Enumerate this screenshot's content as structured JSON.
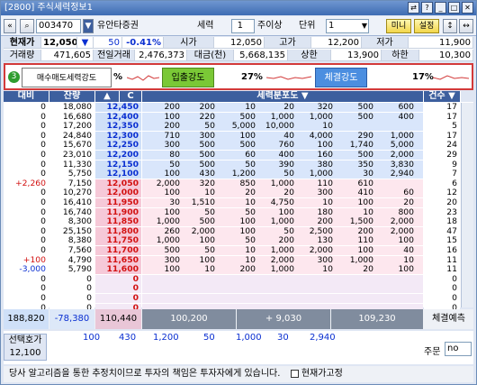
{
  "window": {
    "title": "[2800] 주식세력정보1"
  },
  "toolbar": {
    "code": "003470",
    "name": "유안타증권",
    "sel_label": "세력",
    "sel_value": "1",
    "period": "주이상",
    "unit_label": "단위",
    "unit_value": "1",
    "mini": "미니",
    "settings": "설정"
  },
  "quote": {
    "r1": [
      "현재가",
      "12,050",
      "▼",
      "50",
      "-0.41%",
      "시가",
      "12,050",
      "고가",
      "12,200",
      "저가",
      "11,900"
    ],
    "r2": [
      "거래량",
      "471,605",
      "전일거래",
      "2,476,373",
      "대금(천)",
      "5,668,135",
      "상한",
      "13,900",
      "하한",
      "10,300"
    ]
  },
  "gauge": {
    "step": "3",
    "tooltip": "매수매도세력강도",
    "pct1": "%",
    "label2": "입출강도",
    "pct2": "27%",
    "label3": "체결강도",
    "pct3": "17%"
  },
  "headers": {
    "diff": "대비",
    "remain": "잔량",
    "price_a": "▲",
    "price_c": "C",
    "dist": "세력분포도 ▼",
    "count": "건수 ▼"
  },
  "rows": [
    {
      "diff": "0",
      "rem": "18,080",
      "price": "12,450",
      "d": [
        "200",
        "200",
        "10",
        "20",
        "320",
        "500",
        "600"
      ],
      "cnt": "17"
    },
    {
      "diff": "0",
      "rem": "16,680",
      "price": "12,400",
      "d": [
        "100",
        "220",
        "500",
        "1,000",
        "1,000",
        "500",
        "400"
      ],
      "cnt": "17"
    },
    {
      "diff": "0",
      "rem": "17,200",
      "price": "12,350",
      "d": [
        "200",
        "50",
        "5,000",
        "10,000",
        "10",
        "",
        ""
      ],
      "cnt": "5"
    },
    {
      "diff": "0",
      "rem": "24,840",
      "price": "12,300",
      "d": [
        "710",
        "300",
        "100",
        "40",
        "4,000",
        "290",
        "1,000"
      ],
      "cnt": "17"
    },
    {
      "diff": "0",
      "rem": "15,670",
      "price": "12,250",
      "d": [
        "300",
        "500",
        "500",
        "760",
        "100",
        "1,740",
        "5,000"
      ],
      "cnt": "24"
    },
    {
      "diff": "0",
      "rem": "23,010",
      "price": "12,200",
      "d": [
        "80",
        "500",
        "60",
        "400",
        "160",
        "500",
        "2,000"
      ],
      "cnt": "29"
    },
    {
      "diff": "0",
      "rem": "11,330",
      "price": "12,150",
      "d": [
        "50",
        "500",
        "50",
        "390",
        "380",
        "350",
        "3,830"
      ],
      "cnt": "9"
    },
    {
      "diff": "0",
      "rem": "5,750",
      "price": "12,100",
      "d": [
        "100",
        "430",
        "1,200",
        "50",
        "1,000",
        "30",
        "2,940"
      ],
      "cnt": "7"
    },
    {
      "diff": "+2,260",
      "rem": "7,150",
      "price": "12,050",
      "d": [
        "2,000",
        "320",
        "850",
        "1,000",
        "110",
        "610",
        ""
      ],
      "cnt": "6"
    },
    {
      "diff": "0",
      "rem": "10,270",
      "price": "12,000",
      "d": [
        "100",
        "10",
        "20",
        "20",
        "300",
        "410",
        "60"
      ],
      "cnt": "12"
    },
    {
      "diff": "0",
      "rem": "16,410",
      "price": "11,950",
      "d": [
        "30",
        "1,510",
        "10",
        "4,750",
        "10",
        "100",
        "20"
      ],
      "cnt": "20"
    },
    {
      "diff": "0",
      "rem": "16,740",
      "price": "11,900",
      "d": [
        "100",
        "50",
        "50",
        "100",
        "180",
        "10",
        "800"
      ],
      "cnt": "23"
    },
    {
      "diff": "0",
      "rem": "8,300",
      "price": "11,850",
      "d": [
        "1,000",
        "500",
        "100",
        "1,000",
        "200",
        "1,500",
        "2,000"
      ],
      "cnt": "18"
    },
    {
      "diff": "0",
      "rem": "25,150",
      "price": "11,800",
      "d": [
        "260",
        "2,000",
        "100",
        "50",
        "2,500",
        "200",
        "2,000"
      ],
      "cnt": "47"
    },
    {
      "diff": "0",
      "rem": "8,380",
      "price": "11,750",
      "d": [
        "1,000",
        "100",
        "50",
        "200",
        "130",
        "110",
        "100"
      ],
      "cnt": "15"
    },
    {
      "diff": "0",
      "rem": "7,560",
      "price": "11,700",
      "d": [
        "500",
        "50",
        "10",
        "1,000",
        "2,000",
        "100",
        "40"
      ],
      "cnt": "16"
    },
    {
      "diff": "+100",
      "rem": "4,790",
      "price": "11,650",
      "d": [
        "300",
        "100",
        "10",
        "2,000",
        "300",
        "1,000",
        "10"
      ],
      "cnt": "11"
    },
    {
      "diff": "-3,000",
      "rem": "5,790",
      "price": "11,600",
      "d": [
        "100",
        "10",
        "200",
        "1,000",
        "10",
        "20",
        "100"
      ],
      "cnt": "11"
    },
    {
      "diff": "0",
      "rem": "0",
      "price": "0",
      "d": [
        "",
        "",
        "",
        "",
        "",
        "",
        ""
      ],
      "cnt": "0"
    },
    {
      "diff": "0",
      "rem": "0",
      "price": "0",
      "d": [
        "",
        "",
        "",
        "",
        "",
        "",
        ""
      ],
      "cnt": "0"
    },
    {
      "diff": "0",
      "rem": "0",
      "price": "0",
      "d": [
        "",
        "",
        "",
        "",
        "",
        "",
        ""
      ],
      "cnt": "0"
    },
    {
      "diff": "0",
      "rem": "0",
      "price": "0",
      "d": [
        "",
        "",
        "",
        "",
        "",
        "",
        ""
      ],
      "cnt": "0"
    }
  ],
  "summary": {
    "remain_total": "188,820",
    "diff_total": "-78,380",
    "price_total": "110,440",
    "s1": "100,200",
    "s2": "+ 9,030",
    "s3": "109,230",
    "s4": "체결예측"
  },
  "bottom": {
    "label": "선택호가",
    "price": "12,100",
    "vals": [
      "100",
      "430",
      "1,200",
      "50",
      "1,000",
      "30",
      "2,940"
    ],
    "order_label": "주문",
    "order_value": "no"
  },
  "status": {
    "text": "당사 알고리즘을 통한 추정치이므로 투자의 책임은 투자자에게 있습니다.",
    "check_label": "현재가고정"
  },
  "colors": {
    "ask": "#d9e6fb",
    "bid": "#fde7ee",
    "header": "#3d5f9e",
    "accent_red": "#d21111",
    "accent_blue": "#0a2fd1"
  }
}
